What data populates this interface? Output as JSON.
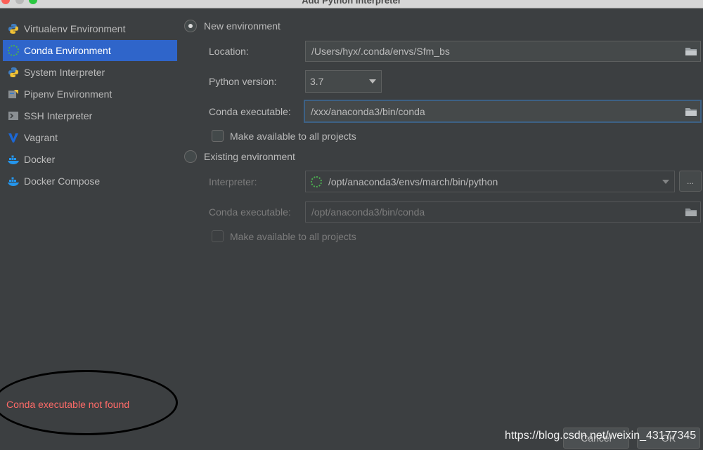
{
  "window": {
    "title": "Add Python Interpreter"
  },
  "sidebar": {
    "items": [
      {
        "label": "Virtualenv Environment",
        "icon": "python-icon"
      },
      {
        "label": "Conda Environment",
        "icon": "conda-icon",
        "selected": true
      },
      {
        "label": "System Interpreter",
        "icon": "python-icon"
      },
      {
        "label": "Pipenv Environment",
        "icon": "pipenv-icon"
      },
      {
        "label": "SSH Interpreter",
        "icon": "terminal-icon"
      },
      {
        "label": "Vagrant",
        "icon": "vagrant-icon"
      },
      {
        "label": "Docker",
        "icon": "docker-icon"
      },
      {
        "label": "Docker Compose",
        "icon": "docker-icon"
      }
    ],
    "error": "Conda executable not found"
  },
  "new_env": {
    "radio_label": "New environment",
    "selected": true,
    "location_label": "Location:",
    "location_value": "/Users/hyx/.conda/envs/Sfm_bs",
    "python_version_label": "Python version:",
    "python_version_value": "3.7",
    "conda_exec_label": "Conda executable:",
    "conda_exec_value": "/xxx/anaconda3/bin/conda",
    "make_available_label": "Make available to all projects"
  },
  "existing_env": {
    "radio_label": "Existing environment",
    "selected": false,
    "interpreter_label": "Interpreter:",
    "interpreter_value": "/opt/anaconda3/envs/march/bin/python",
    "browse_label": "...",
    "conda_exec_label": "Conda executable:",
    "conda_exec_value": "/opt/anaconda3/bin/conda",
    "make_available_label": "Make available to all projects"
  },
  "footer": {
    "cancel_label": "Cancel",
    "ok_label": "OK",
    "watermark": "https://blog.csdn.net/weixin_43177345"
  },
  "colors": {
    "background": "#3c3f41",
    "selection": "#2f65ca",
    "error": "#ff6b68",
    "focus_border": "#3d6185"
  }
}
